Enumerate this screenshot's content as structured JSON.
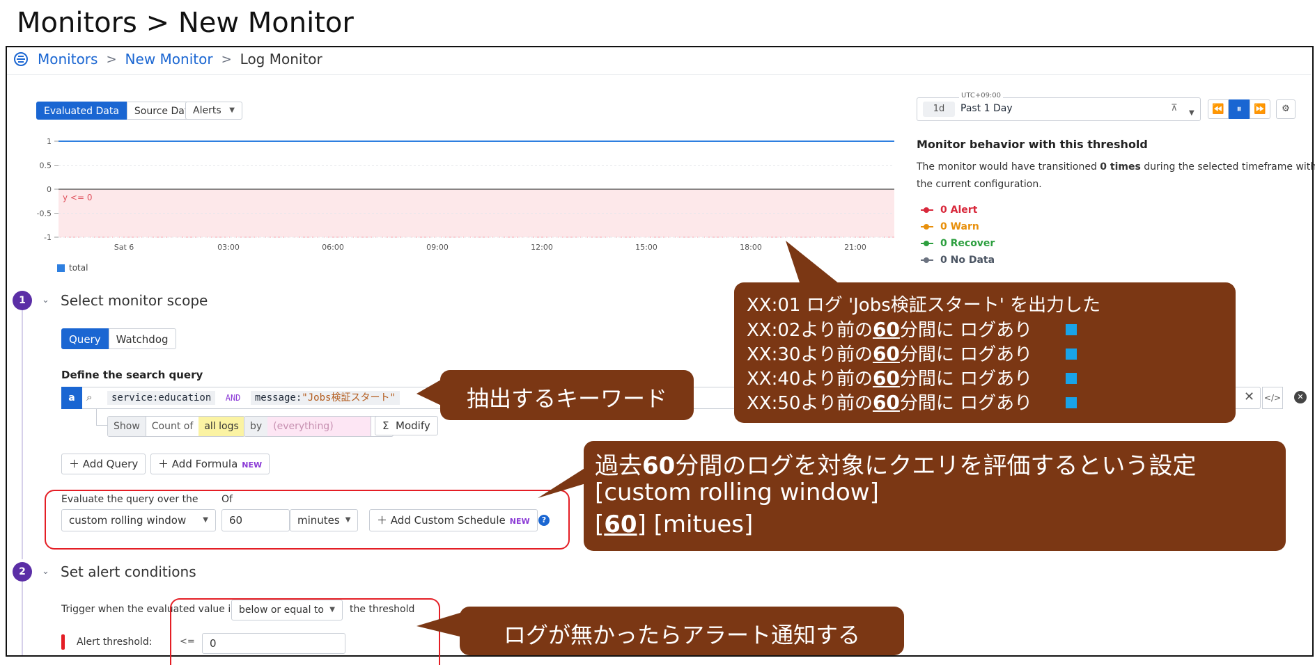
{
  "slide_title": "Monitors > New Monitor",
  "breadcrumb": {
    "monitors": "Monitors",
    "new_monitor": "New Monitor",
    "current": "Log Monitor",
    "sep": ">"
  },
  "graph_tabs": {
    "evaluated": "Evaluated Data",
    "source": "Source Data",
    "alerts": "Alerts"
  },
  "chart_data": {
    "type": "line",
    "yticks": [
      "1",
      "0.5",
      "0",
      "-0.5",
      "-1"
    ],
    "ylim": [
      -1,
      1
    ],
    "xticks": [
      "Sat 6",
      "03:00",
      "06:00",
      "09:00",
      "12:00",
      "15:00",
      "18:00",
      "21:00"
    ],
    "series": [
      {
        "name": "total",
        "values": [
          1,
          1
        ]
      }
    ],
    "threshold_label": "y <= 0",
    "threshold": 0,
    "colors": {
      "line": "#2e7fe0",
      "zone": "#fde8ea",
      "zone_line": "#f6a3ac"
    }
  },
  "timeframe": {
    "tz": "UTC+09:00",
    "short": "1d",
    "label": "Past 1 Day"
  },
  "behavior": {
    "title": "Monitor behavior with this threshold",
    "text_1": "The monitor would have transitioned",
    "count": "0 times",
    "text_2": "during the selected timeframe with",
    "text_3": "the current configuration.",
    "statuses": [
      {
        "label": "0 Alert",
        "color": "#d8283b"
      },
      {
        "label": "0 Warn",
        "color": "#e8900c"
      },
      {
        "label": "0 Recover",
        "color": "#2d9f3f"
      },
      {
        "label": "0 No Data",
        "color": "#6b7280"
      }
    ]
  },
  "section1": {
    "num": "1",
    "title": "Select monitor scope",
    "tab_query": "Query",
    "tab_watchdog": "Watchdog",
    "define_label": "Define the search query"
  },
  "query": {
    "letter": "a",
    "term1": "service:education",
    "op": "AND",
    "term2_key": "message:",
    "term2_val": "\"Jobs検証スタート\"",
    "show": "Show",
    "count_of": "Count of",
    "all_logs": "all logs",
    "by": "by",
    "everything": "(everything)",
    "modify": "Modify",
    "add_query": "Add Query",
    "add_formula": "Add Formula",
    "new_badge": "NEW"
  },
  "evaluate": {
    "label": "Evaluate the query over the",
    "of": "Of",
    "window": "custom rolling window",
    "value": "60",
    "unit": "minutes",
    "add_schedule": "Add Custom Schedule"
  },
  "section2": {
    "num": "2",
    "title": "Set alert conditions",
    "trigger_pre": "Trigger when the evaluated value is",
    "comparator": "below or equal to",
    "trigger_post": "the threshold",
    "alert_label": "Alert threshold:",
    "alert_op": "<=",
    "alert_value": "0"
  },
  "callouts": {
    "schedule_line1": "XX:01 ログ 'Jobs検証スタート' を出力した",
    "schedule_rows": [
      {
        "pre": "XX:02より前の",
        "num": "60",
        "post": "分間に ログあり"
      },
      {
        "pre": "XX:30より前の",
        "num": "60",
        "post": "分間に ログあり"
      },
      {
        "pre": "XX:40より前の",
        "num": "60",
        "post": "分間に ログあり"
      },
      {
        "pre": "XX:50より前の",
        "num": "60",
        "post": "分間に ログあり"
      }
    ],
    "keyword": "抽出するキーワード",
    "window_line1_pre": "過去",
    "window_line1_num": "60",
    "window_line1_post": "分間のログを対象にクエリを評価するという設定",
    "window_line2": "[custom rolling window]",
    "window_line3_open": "[",
    "window_line3_num": "60",
    "window_line3_close": "] [mitues]",
    "alert": "ログが無かったらアラート通知する"
  }
}
